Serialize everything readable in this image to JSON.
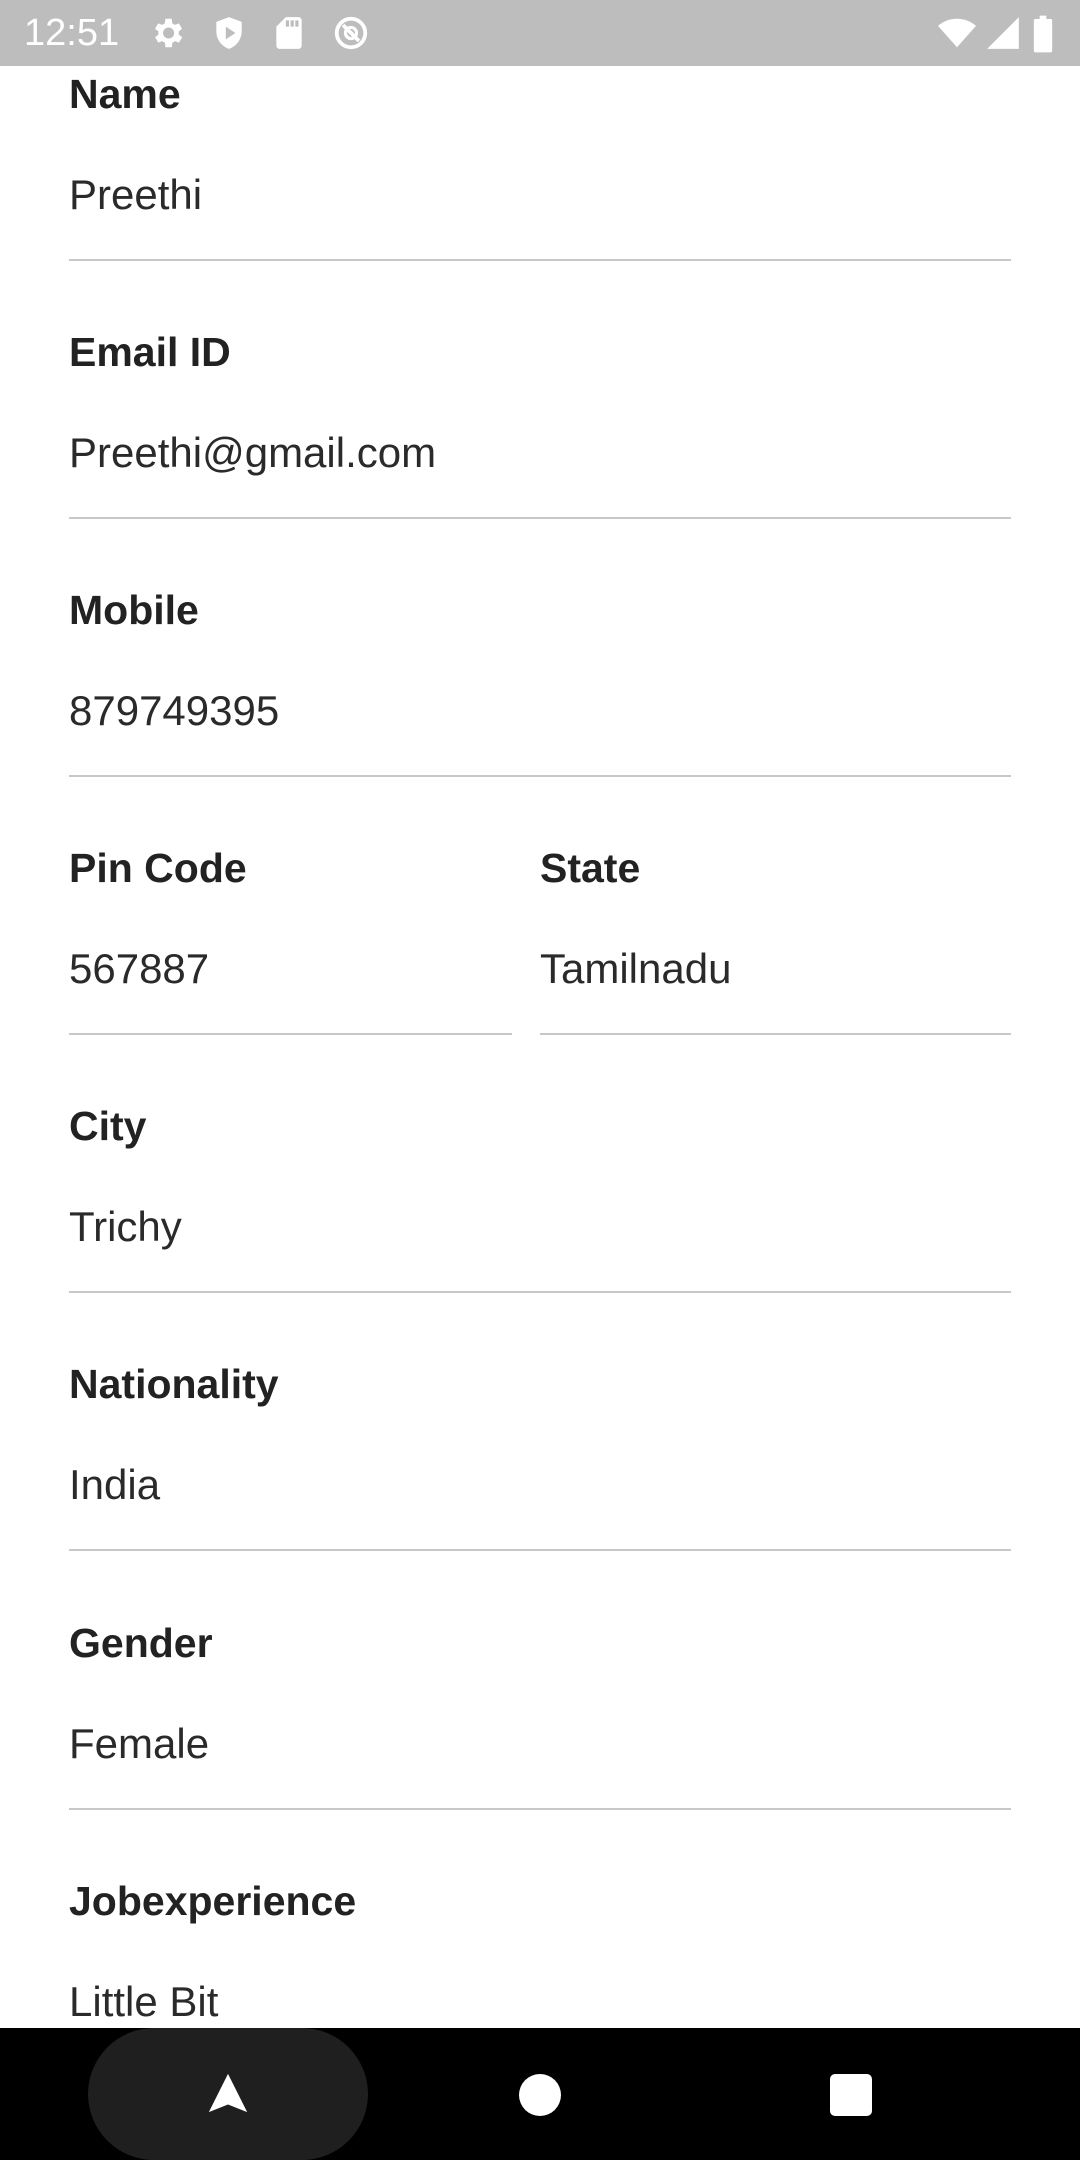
{
  "status_bar": {
    "time": "12:51",
    "left_icons": [
      "settings-icon",
      "shield-icon",
      "sd-card-icon",
      "do-not-disturb-icon"
    ],
    "right_icons": [
      "wifi-icon",
      "cell-signal-icon",
      "battery-icon"
    ]
  },
  "form": {
    "name": {
      "label": "Name",
      "value": "Preethi"
    },
    "email": {
      "label": "Email ID",
      "value": "Preethi@gmail.com"
    },
    "mobile": {
      "label": "Mobile",
      "value": "879749395"
    },
    "pincode": {
      "label": "Pin Code",
      "value": "567887"
    },
    "state": {
      "label": "State",
      "value": "Tamilnadu"
    },
    "city": {
      "label": "City",
      "value": "Trichy"
    },
    "nationality": {
      "label": "Nationality",
      "value": "India"
    },
    "gender": {
      "label": "Gender",
      "value": "Female"
    },
    "jobexperience": {
      "label": "Jobexperience",
      "value": "Little Bit"
    }
  },
  "nav_bar": {
    "buttons": [
      "back-icon",
      "home-icon",
      "recents-icon"
    ]
  },
  "colors": {
    "status_bar": "#bdbdbd",
    "label_text": "#222222",
    "value_text": "#2a2a2a",
    "divider": "#c8c8c8",
    "nav_bar": "#000000"
  }
}
